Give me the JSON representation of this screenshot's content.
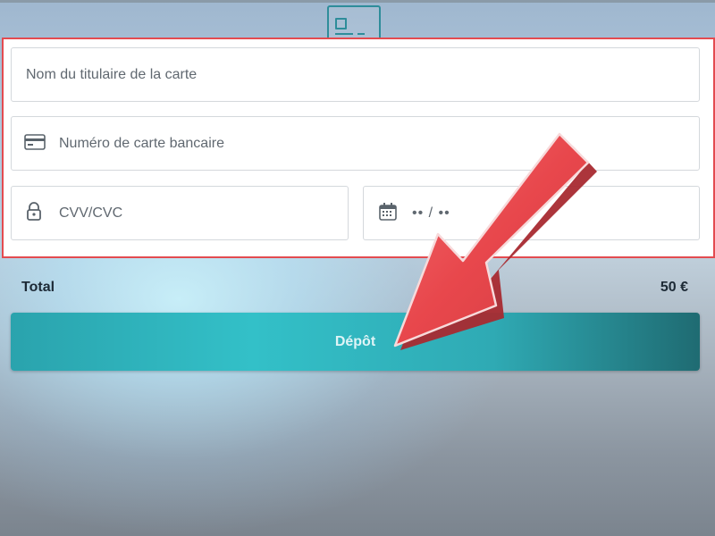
{
  "form": {
    "cardholder_placeholder": "Nom du titulaire de la carte",
    "card_number_placeholder": "Numéro de carte bancaire",
    "cvv_placeholder": "CVV/CVC",
    "expiry_placeholder": "•• / ••",
    "icons": {
      "card_logo": "credit-card-icon",
      "card_number": "credit-card-icon",
      "cvv": "lock-icon",
      "expiry": "calendar-icon"
    }
  },
  "summary": {
    "total_label": "Total",
    "total_value": "50 €"
  },
  "actions": {
    "deposit_label": "Dépôt"
  },
  "colors": {
    "accent": "#33c0c8",
    "highlight": "#e34b50",
    "arrow": "#e8474c"
  }
}
